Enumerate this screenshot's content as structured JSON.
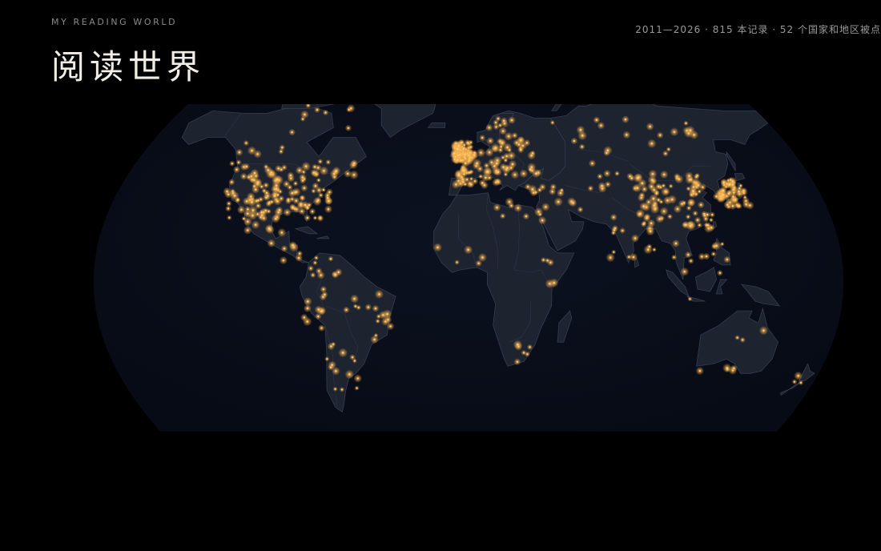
{
  "header": {
    "eyebrow": "MY READING WORLD",
    "title": "阅读世界",
    "stats": "2011—2026 · 815 本记录 · 52 个国家和地区被点"
  },
  "map": {
    "projection": "natural-earth",
    "record_count": 815,
    "country_count": 52,
    "year_range": [
      2011,
      2026
    ],
    "colors": {
      "background": "#000000",
      "ocean": "#0a0f1c",
      "land": "#1e2330",
      "land_border": "#363c4b",
      "point": "#ffd27a",
      "point_glow": "#f0a844"
    },
    "clusters": [
      {
        "region": "United States",
        "lon": [
          -124,
          -70
        ],
        "lat": [
          26,
          48
        ],
        "count": 140
      },
      {
        "region": "Western Canada",
        "lon": [
          -128,
          -100
        ],
        "lat": [
          49,
          58
        ],
        "count": 8
      },
      {
        "region": "Eastern Canada",
        "lon": [
          -82,
          -60
        ],
        "lat": [
          44,
          50
        ],
        "count": 8
      },
      {
        "region": "Canadian Arctic",
        "lon": [
          -110,
          -70
        ],
        "lat": [
          60,
          75
        ],
        "count": 10
      },
      {
        "region": "Mexico",
        "lon": [
          -110,
          -90
        ],
        "lat": [
          16,
          30
        ],
        "count": 10
      },
      {
        "region": "Central America",
        "lon": [
          -92,
          -78
        ],
        "lat": [
          8,
          17
        ],
        "count": 6
      },
      {
        "region": "Colombia & Venezuela",
        "lon": [
          -77,
          -62
        ],
        "lat": [
          2,
          11
        ],
        "count": 10
      },
      {
        "region": "Andes",
        "lon": [
          -80,
          -68
        ],
        "lat": [
          -20,
          0
        ],
        "count": 12
      },
      {
        "region": "Brazil",
        "lon": [
          -60,
          -38
        ],
        "lat": [
          -25,
          -5
        ],
        "count": 16
      },
      {
        "region": "Southern Cone",
        "lon": [
          -72,
          -57
        ],
        "lat": [
          -45,
          -25
        ],
        "count": 14
      },
      {
        "region": "United Kingdom & Ireland",
        "lon": [
          -8,
          2
        ],
        "lat": [
          50,
          58
        ],
        "count": 90
      },
      {
        "region": "Western Europe",
        "lon": [
          -8,
          16
        ],
        "lat": [
          40,
          54
        ],
        "count": 60
      },
      {
        "region": "Northern Europe",
        "lon": [
          5,
          30
        ],
        "lat": [
          55,
          68
        ],
        "count": 20
      },
      {
        "region": "Eastern Europe",
        "lon": [
          15,
          40
        ],
        "lat": [
          44,
          58
        ],
        "count": 30
      },
      {
        "region": "Turkey & Caucasus",
        "lon": [
          27,
          48
        ],
        "lat": [
          36,
          42
        ],
        "count": 10
      },
      {
        "region": "Middle East",
        "lon": [
          34,
          58
        ],
        "lat": [
          22,
          36
        ],
        "count": 8
      },
      {
        "region": "Russia",
        "lon": [
          45,
          140
        ],
        "lat": [
          52,
          68
        ],
        "count": 22
      },
      {
        "region": "Central Asia",
        "lon": [
          55,
          80
        ],
        "lat": [
          38,
          50
        ],
        "count": 8
      },
      {
        "region": "China",
        "lon": [
          85,
          122
        ],
        "lat": [
          22,
          45
        ],
        "count": 95
      },
      {
        "region": "Korea",
        "lon": [
          126,
          130
        ],
        "lat": [
          34,
          38
        ],
        "count": 10
      },
      {
        "region": "Japan",
        "lon": [
          130,
          142
        ],
        "lat": [
          31,
          43
        ],
        "count": 45
      },
      {
        "region": "South Asia",
        "lon": [
          68,
          90
        ],
        "lat": [
          8,
          30
        ],
        "count": 14
      },
      {
        "region": "Southeast Asia",
        "lon": [
          98,
          125
        ],
        "lat": [
          -8,
          18
        ],
        "count": 14
      },
      {
        "region": "West Africa",
        "lon": [
          -17,
          8
        ],
        "lat": [
          5,
          15
        ],
        "count": 5
      },
      {
        "region": "North Africa",
        "lon": [
          -8,
          32
        ],
        "lat": [
          26,
          36
        ],
        "count": 6
      },
      {
        "region": "East Africa",
        "lon": [
          30,
          42
        ],
        "lat": [
          -5,
          12
        ],
        "count": 5
      },
      {
        "region": "Southern Africa",
        "lon": [
          18,
          32
        ],
        "lat": [
          -34,
          -22
        ],
        "count": 6
      },
      {
        "region": "Australia",
        "lon": [
          115,
          153
        ],
        "lat": [
          -38,
          -20
        ],
        "count": 8
      },
      {
        "region": "New Zealand",
        "lon": [
          168,
          178
        ],
        "lat": [
          -46,
          -36
        ],
        "count": 3
      }
    ]
  }
}
